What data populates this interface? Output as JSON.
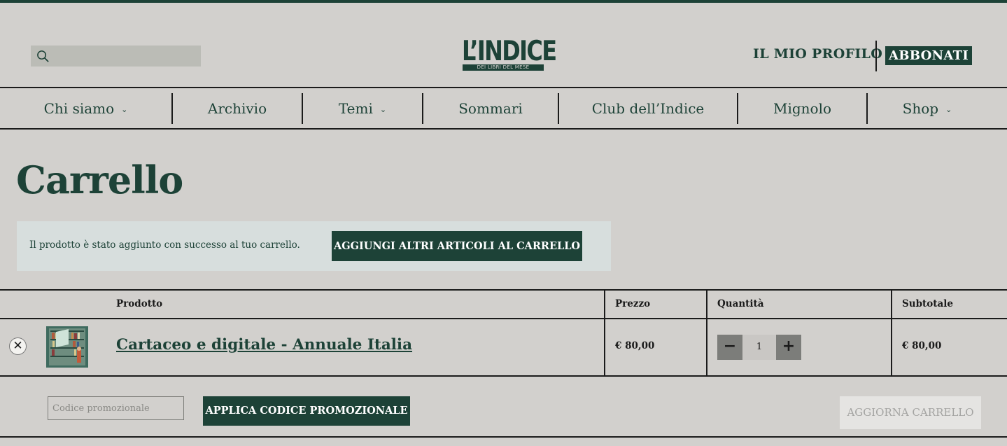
{
  "header": {
    "search_placeholder": "",
    "logo_main": "L’INDICE",
    "logo_sub": "DEI LIBRI DEL MESE",
    "profile_label": "IL MIO PROFILO",
    "subscribe_label": "ABBONATI"
  },
  "nav": {
    "items": [
      {
        "label": "Chi siamo",
        "dropdown": true
      },
      {
        "label": "Archivio",
        "dropdown": false
      },
      {
        "label": "Temi",
        "dropdown": true
      },
      {
        "label": "Sommari",
        "dropdown": false
      },
      {
        "label": "Club dell’Indice",
        "dropdown": false
      },
      {
        "label": "Mignolo",
        "dropdown": false
      },
      {
        "label": "Shop",
        "dropdown": true
      }
    ],
    "chevron": "⌄"
  },
  "page": {
    "title": "Carrello"
  },
  "notice": {
    "message": "Il prodotto è stato aggiunto con successo al tuo carrello.",
    "button_label": "AGGIUNGI ALTRI ARTICOLI AL CARRELLO"
  },
  "cart": {
    "headers": {
      "product": "Prodotto",
      "price": "Prezzo",
      "quantity": "Quantità",
      "subtotal": "Subtotale"
    },
    "rows": [
      {
        "remove_symbol": "✕",
        "product_name": "Cartaceo e digitale - Annuale Italia",
        "price": "€ 80,00",
        "quantity": "1",
        "subtotal": "€ 80,00"
      }
    ],
    "qty_minus": "−",
    "qty_plus": "+"
  },
  "actions": {
    "coupon_placeholder": "Codice promozionale",
    "apply_label": "APPLICA CODICE PROMOZIONALE",
    "update_label": "AGGIORNA CARRELLO"
  },
  "colors": {
    "brand": "#1d4237",
    "background": "#d2d0cd",
    "notice_bg": "#d7dedd",
    "disabled_button": "#e5e4e2"
  }
}
